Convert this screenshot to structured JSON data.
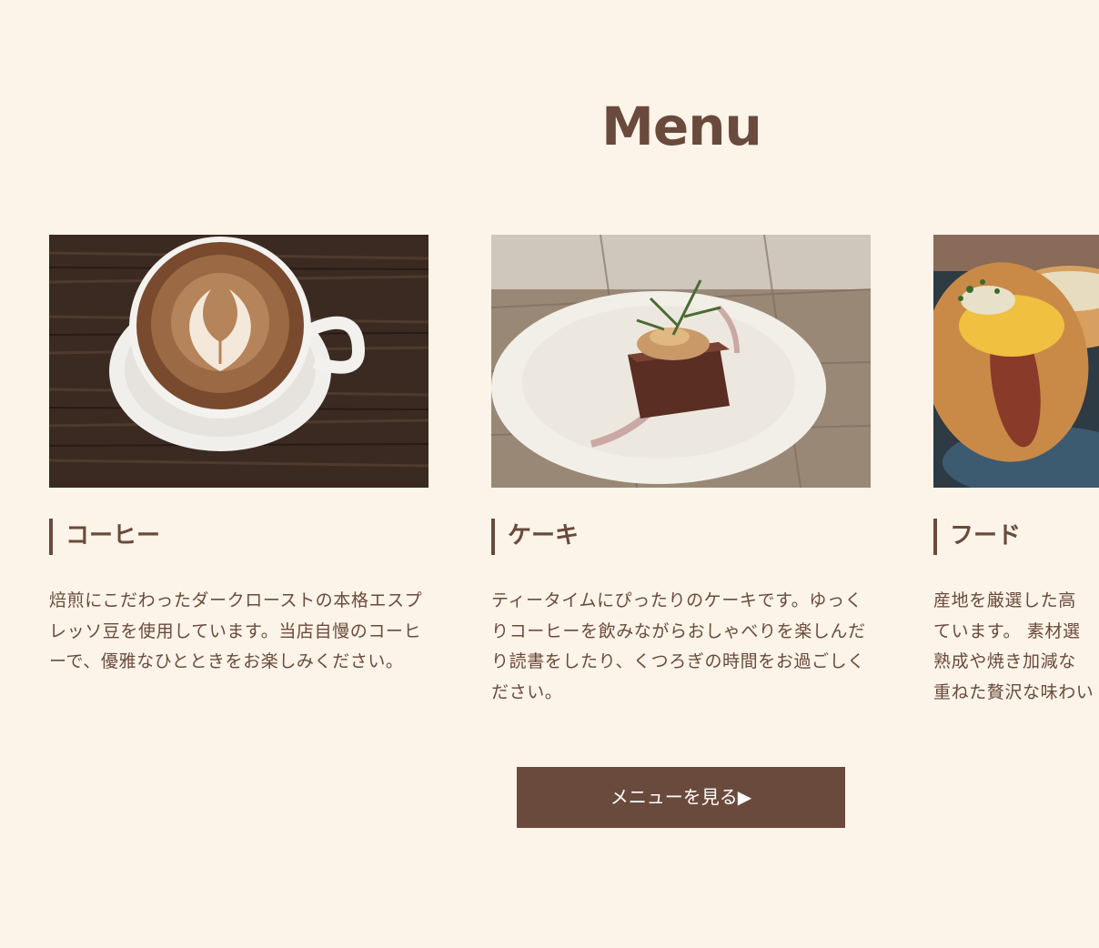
{
  "section": {
    "title": "Menu"
  },
  "cards": [
    {
      "title": "コーヒー",
      "description": "焙煎にこだわったダークローストの本格エスプレッソ豆を使用しています。当店自慢のコーヒーで、優雅なひとときをお楽しみください。",
      "image_subject": "latte-art-coffee-cup"
    },
    {
      "title": "ケーキ",
      "description": "ティータイムにぴったりのケーキです。ゆっくりコーヒーを飲みながらおしゃべりを楽しんだり読書をしたり、くつろぎの時間をお過ごしください。",
      "image_subject": "chocolate-cake-on-plate"
    },
    {
      "title": "フード",
      "description": "産地を厳選した高\nています。 素材選\n熟成や焼き加減な\n重ねた贅沢な味わい",
      "image_subject": "hot-dogs"
    }
  ],
  "button": {
    "label": "メニューを見る▶"
  },
  "colors": {
    "background": "#fcf4e8",
    "accent": "#6a4a3c",
    "button_text": "#ffffff"
  }
}
